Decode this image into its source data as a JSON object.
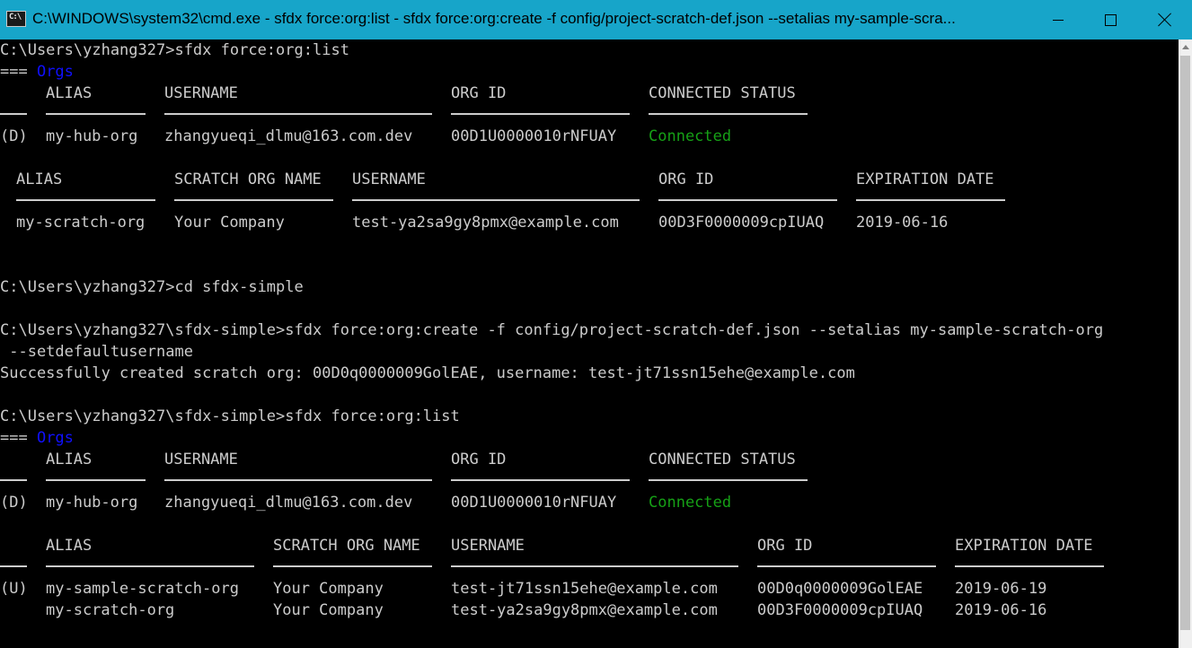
{
  "window": {
    "title": "C:\\WINDOWS\\system32\\cmd.exe - sfdx  force:org:list - sfdx  force:org:create -f config/project-scratch-def.json --setalias my-sample-scra...",
    "icon_label": "C:\\"
  },
  "colors": {
    "titlebar": "#17a5c9",
    "background": "#000000",
    "text": "#cccccc",
    "orgs_header": "#1010ff",
    "connected": "#16a016"
  },
  "console": {
    "cmd1": "C:\\Users\\yzhang327>sfdx force:org:list",
    "orgs1_prefix": "=== ",
    "orgs1_label": "Orgs",
    "hub1": {
      "headers": {
        "alias": "ALIAS",
        "username": "USERNAME",
        "org_id": "ORG ID",
        "status": "CONNECTED STATUS"
      },
      "row": {
        "flag": "(D)",
        "alias": "my-hub-org",
        "username": "zhangyueqi_dlmu@163.com.dev",
        "org_id": "00D1U0000010rNFUAY",
        "status": "Connected"
      }
    },
    "scratch1": {
      "headers": {
        "alias": "ALIAS",
        "name": "SCRATCH ORG NAME",
        "username": "USERNAME",
        "org_id": "ORG ID",
        "expiration": "EXPIRATION DATE"
      },
      "row": {
        "alias": "my-scratch-org",
        "name": "Your Company",
        "username": "test-ya2sa9gy8pmx@example.com",
        "org_id": "00D3F0000009cpIUAQ",
        "expiration": "2019-06-16"
      }
    },
    "cmd2": "C:\\Users\\yzhang327>cd sfdx-simple",
    "cmd3": "C:\\Users\\yzhang327\\sfdx-simple>sfdx force:org:create -f config/project-scratch-def.json --setalias my-sample-scratch-org",
    "cmd3_cont": " --setdefaultusername",
    "create_result": "Successfully created scratch org: 00D0q0000009GolEAE, username: test-jt71ssn15ehe@example.com",
    "cmd4": "C:\\Users\\yzhang327\\sfdx-simple>sfdx force:org:list",
    "orgs2_prefix": "=== ",
    "orgs2_label": "Orgs",
    "hub2": {
      "headers": {
        "alias": "ALIAS",
        "username": "USERNAME",
        "org_id": "ORG ID",
        "status": "CONNECTED STATUS"
      },
      "row": {
        "flag": "(D)",
        "alias": "my-hub-org",
        "username": "zhangyueqi_dlmu@163.com.dev",
        "org_id": "00D1U0000010rNFUAY",
        "status": "Connected"
      }
    },
    "scratch2": {
      "headers": {
        "alias": "ALIAS",
        "name": "SCRATCH ORG NAME",
        "username": "USERNAME",
        "org_id": "ORG ID",
        "expiration": "EXPIRATION DATE"
      },
      "rows": [
        {
          "flag": "(U)",
          "alias": "my-sample-scratch-org",
          "name": "Your Company",
          "username": "test-jt71ssn15ehe@example.com",
          "org_id": "00D0q0000009GolEAE",
          "expiration": "2019-06-19"
        },
        {
          "flag": "",
          "alias": "my-scratch-org",
          "name": "Your Company",
          "username": "test-ya2sa9gy8pmx@example.com",
          "org_id": "00D3F0000009cpIUAQ",
          "expiration": "2019-06-16"
        }
      ]
    }
  }
}
